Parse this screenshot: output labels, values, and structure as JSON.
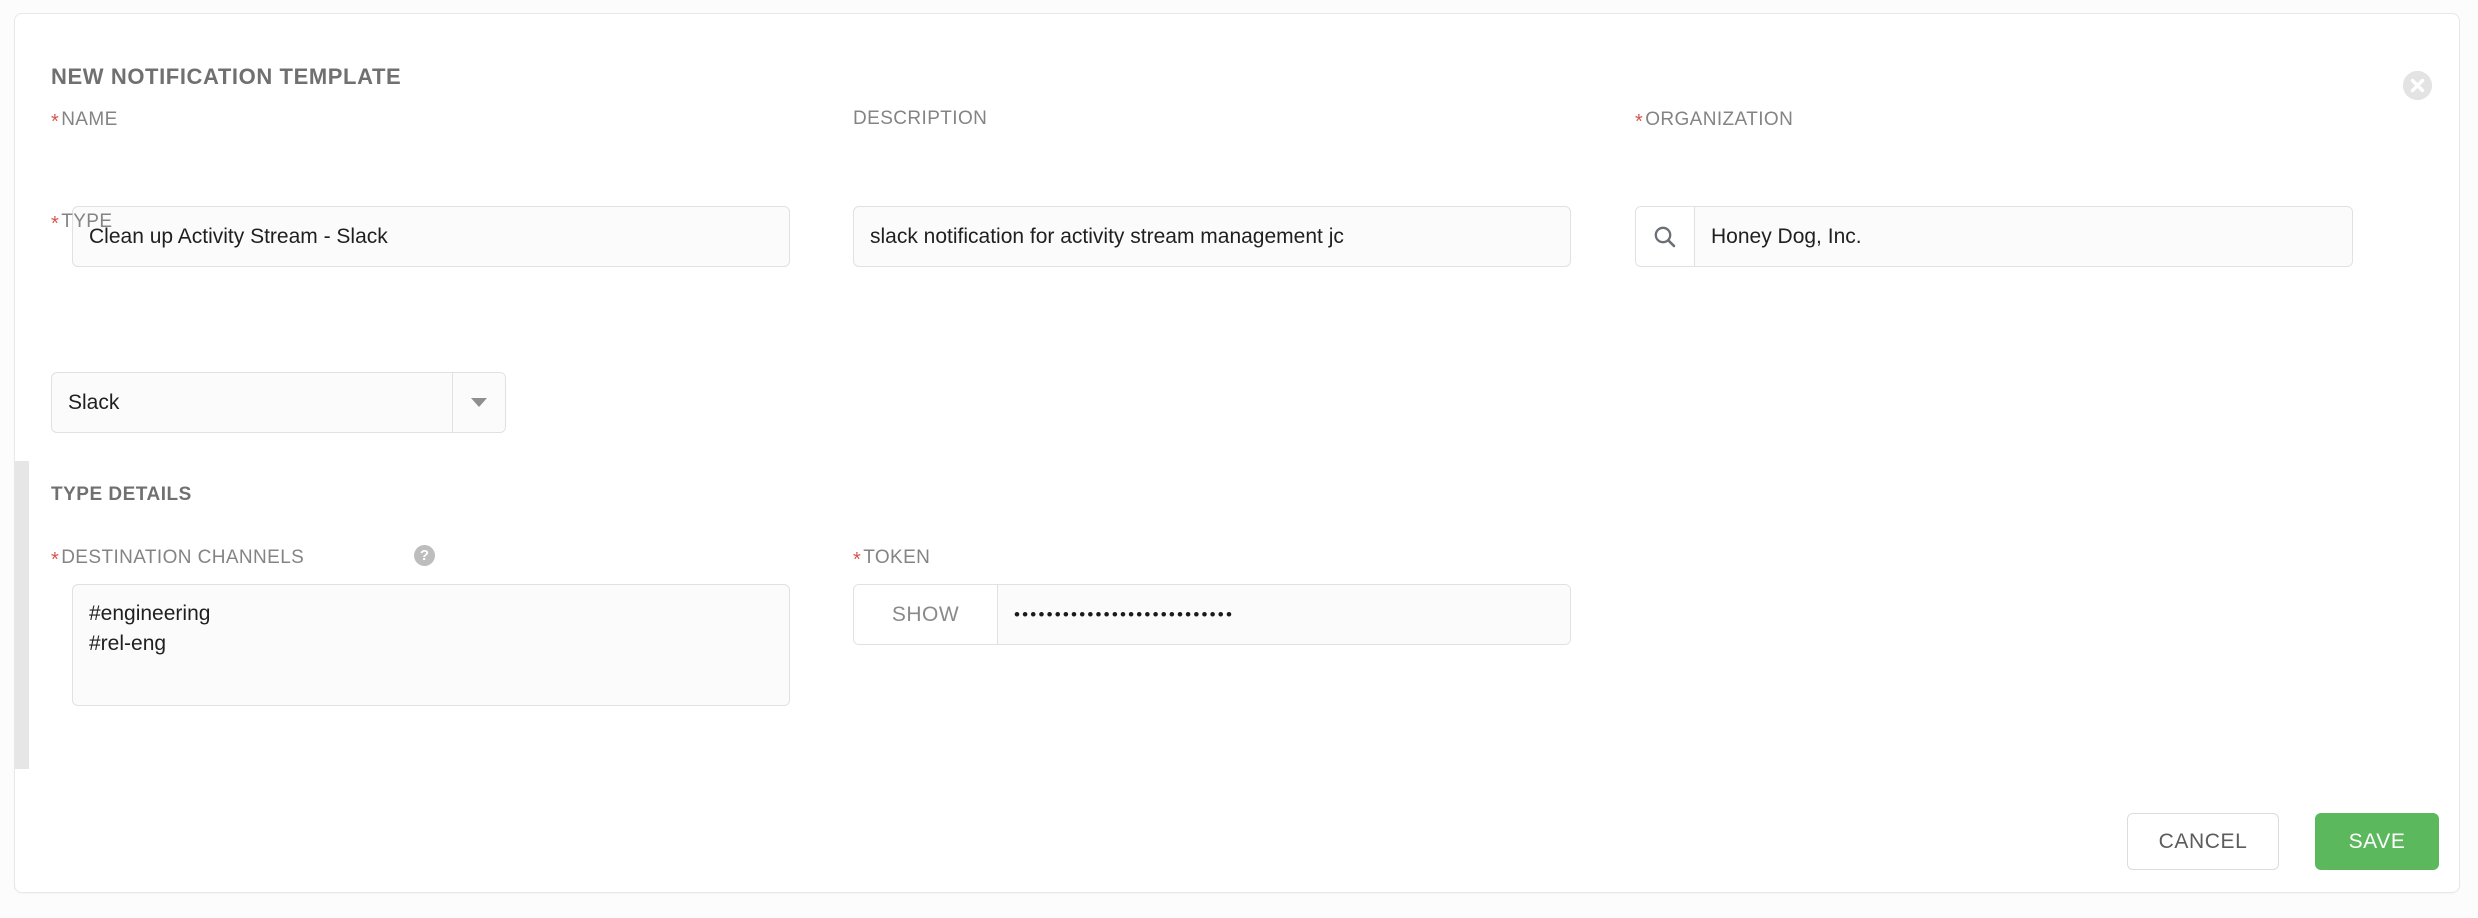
{
  "form": {
    "title": "NEW NOTIFICATION TEMPLATE",
    "close_icon": "close-circle-icon"
  },
  "fields": {
    "name": {
      "label": "NAME",
      "required_marker": "*",
      "value": "Clean up Activity Stream - Slack",
      "placeholder": ""
    },
    "description": {
      "label": "DESCRIPTION",
      "value": "slack notification for activity stream management jc",
      "placeholder": ""
    },
    "organization": {
      "label": "ORGANIZATION",
      "required_marker": "*",
      "value": "Honey Dog, Inc.",
      "placeholder": "",
      "lookup_icon": "search-icon"
    },
    "type": {
      "label": "TYPE",
      "required_marker": "*",
      "selected": "Slack",
      "caret_icon": "chevron-down-icon"
    }
  },
  "type_details": {
    "section_label": "TYPE DETAILS",
    "destination_channels": {
      "label": "DESTINATION CHANNELS",
      "required_marker": "*",
      "help_icon": "question-mark-icon",
      "help_glyph": "?",
      "value": "#engineering\n#rel-eng",
      "placeholder": ""
    },
    "token": {
      "label": "TOKEN",
      "required_marker": "*",
      "show_label": "SHOW",
      "masked_value": "•••••••••••••••••••••••••••",
      "placeholder": ""
    }
  },
  "footer": {
    "cancel_label": "CANCEL",
    "save_label": "SAVE"
  },
  "colors": {
    "required_red": "#d9534f",
    "save_green": "#5cb85c",
    "label_gray": "#848484",
    "border_gray": "#e1e1e1"
  }
}
